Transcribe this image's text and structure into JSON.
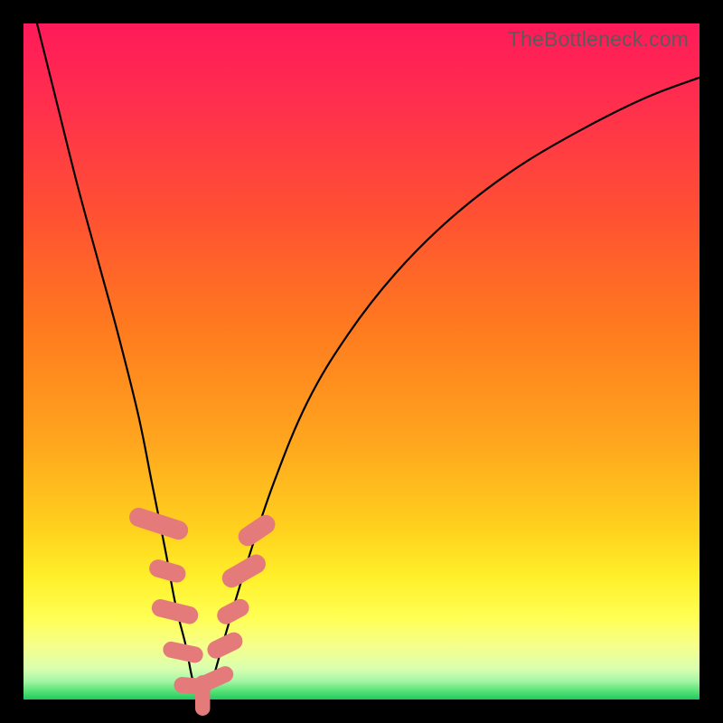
{
  "watermark": "TheBottleneck.com",
  "gradient_colors": {
    "c0": "#ff1a5a",
    "c1": "#ff2f4d",
    "c2": "#ff5033",
    "c3": "#ff7a1f",
    "c4": "#ffa61e",
    "c5": "#ffd21e",
    "c6": "#fff02a",
    "c7": "#ffff55",
    "c8": "#f6ff8a",
    "c9": "#d9ffb0",
    "c10": "#a6f7a6",
    "c11": "#5fe47a",
    "c12": "#1fc95e"
  },
  "chart_data": {
    "type": "line",
    "title": "",
    "xlabel": "",
    "ylabel": "",
    "xlim": [
      0,
      100
    ],
    "ylim": [
      0,
      100
    ],
    "grid": false,
    "legend_position": "none",
    "series": [
      {
        "name": "curve",
        "x": [
          2,
          5,
          8,
          11,
          14,
          17,
          19,
          21,
          22.5,
          24,
          25,
          26,
          27,
          28,
          30,
          33,
          37,
          42,
          48,
          55,
          63,
          72,
          82,
          92,
          100
        ],
        "values": [
          100,
          88,
          76,
          65,
          54,
          42,
          32,
          22,
          14,
          8,
          3,
          0.5,
          0.5,
          3,
          10,
          20,
          32,
          44,
          54,
          63,
          71,
          78,
          84,
          89,
          92
        ]
      }
    ],
    "markers": [
      {
        "x": 20.0,
        "y": 26,
        "w": 2.8,
        "h": 9,
        "rot": -72
      },
      {
        "x": 21.3,
        "y": 19,
        "w": 2.6,
        "h": 5.5,
        "rot": -74
      },
      {
        "x": 22.4,
        "y": 13,
        "w": 2.6,
        "h": 7,
        "rot": -76
      },
      {
        "x": 23.6,
        "y": 7,
        "w": 2.4,
        "h": 6,
        "rot": -78
      },
      {
        "x": 25.0,
        "y": 2,
        "w": 2.4,
        "h": 5.5,
        "rot": -85
      },
      {
        "x": 26.5,
        "y": 0.6,
        "w": 2.2,
        "h": 6,
        "rot": 0
      },
      {
        "x": 28.2,
        "y": 3,
        "w": 2.4,
        "h": 6,
        "rot": 66
      },
      {
        "x": 29.8,
        "y": 8,
        "w": 2.6,
        "h": 5.5,
        "rot": 64
      },
      {
        "x": 31.0,
        "y": 13,
        "w": 2.6,
        "h": 5,
        "rot": 62
      },
      {
        "x": 32.6,
        "y": 19,
        "w": 2.8,
        "h": 7,
        "rot": 60
      },
      {
        "x": 34.5,
        "y": 25,
        "w": 2.8,
        "h": 6,
        "rot": 56
      }
    ]
  }
}
